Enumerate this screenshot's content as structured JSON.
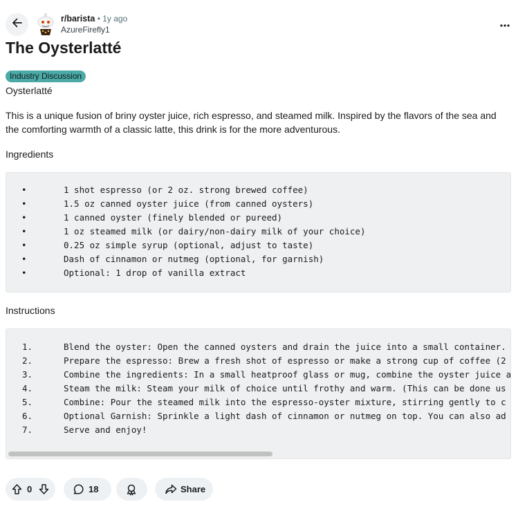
{
  "post": {
    "subreddit": "r/barista",
    "separator": "•",
    "time": "1y ago",
    "author": "AzureFirefly1",
    "title": "The Oysterlatté",
    "flair": {
      "label": "Industry Discussion",
      "color": "#4ba9a6"
    },
    "subtitle": "Oysterlatté",
    "intro": "This is a unique fusion of briny oyster juice, rich espresso, and steamed milk. Inspired by the flavors of the sea and the comforting warmth of a classic latte, this drink is for the more adventurous."
  },
  "ingredients": {
    "heading": "Ingredients",
    "bullet": "•",
    "items": [
      "1 shot espresso (or 2 oz. strong brewed coffee)",
      "1.5 oz canned oyster juice (from canned oysters)",
      "1 canned oyster (finely blended or pureed)",
      "1 oz steamed milk (or dairy/non-dairy milk of your choice)",
      "0.25 oz simple syrup (optional, adjust to taste)",
      "Dash of cinnamon or nutmeg (optional, for garnish)",
      "Optional: 1 drop of vanilla extract"
    ]
  },
  "instructions": {
    "heading": "Instructions",
    "items": [
      {
        "num": "1.",
        "text": "Blend the oyster: Open the canned oysters and drain the juice into a small container."
      },
      {
        "num": "2.",
        "text": "Prepare the espresso: Brew a fresh shot of espresso or make a strong cup of coffee (2"
      },
      {
        "num": "3.",
        "text": "Combine the ingredients: In a small heatproof glass or mug, combine the oyster juice a"
      },
      {
        "num": "4.",
        "text": "Steam the milk: Steam your milk of choice until frothy and warm. (This can be done us"
      },
      {
        "num": "5.",
        "text": "Combine: Pour the steamed milk into the espresso-oyster mixture, stirring gently to c"
      },
      {
        "num": "6.",
        "text": "Optional Garnish: Sprinkle a light dash of cinnamon or nutmeg on top. You can also ad"
      },
      {
        "num": "7.",
        "text": "Serve and enjoy!"
      }
    ]
  },
  "actions": {
    "votes": "0",
    "comments": "18",
    "share_label": "Share"
  },
  "icons": {
    "back": "arrow-left-icon",
    "more": "ellipsis-icon",
    "upvote": "arrow-up-icon",
    "downvote": "arrow-down-icon",
    "comment": "speech-bubble-icon",
    "award": "award-ribbon-icon",
    "share": "share-arrow-icon"
  }
}
